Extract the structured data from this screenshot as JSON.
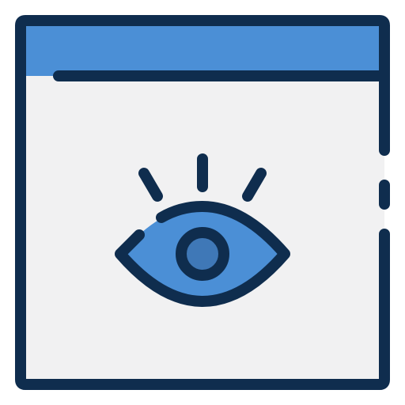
{
  "icon": {
    "name": "browser-window-eye-icon",
    "parts": [
      "browser-window-icon",
      "title-bar",
      "eye-icon",
      "eyelashes",
      "iris",
      "pupil"
    ]
  },
  "colors": {
    "outline": "#0f2d4e",
    "window_fill": "#f1f1f2",
    "title_bar": "#4b8fd6",
    "eye_fill": "#4b8fd6",
    "iris": "#3f78b7",
    "background": "#ffffff"
  }
}
